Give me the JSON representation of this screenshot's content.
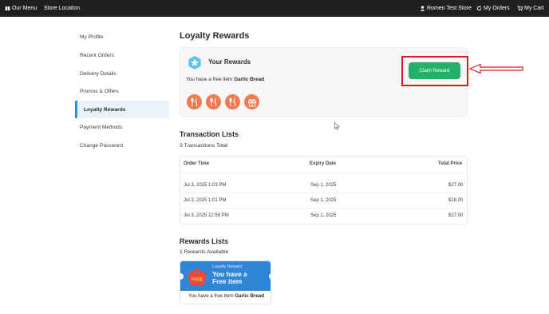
{
  "topbar": {
    "our_menu": "Our Menu",
    "store_location": "Store Location",
    "user_name": "Romeo Test Store",
    "my_orders": "My Orders",
    "my_cart": "My Cart"
  },
  "sidebar": {
    "items": [
      {
        "label": "My Profile"
      },
      {
        "label": "Recent Orders"
      },
      {
        "label": "Delivery Details"
      },
      {
        "label": "Promos & Offers"
      },
      {
        "label": "Loyalty Rewards"
      },
      {
        "label": "Payment Methods"
      },
      {
        "label": "Change Password"
      }
    ],
    "active_index": 4
  },
  "page": {
    "title": "Loyalty Rewards"
  },
  "rewards_card": {
    "heading": "Your Rewards",
    "free_text_prefix": "You have a free item",
    "free_item_name": "Garlic Bread",
    "claim_button": "Claim Reward",
    "stamps": [
      "fork-knife-icon",
      "fork-knife-icon",
      "fork-knife-icon",
      "gift-icon"
    ]
  },
  "transactions": {
    "title": "Transaction Lists",
    "subtitle": "3 Transactions Total",
    "headers": {
      "order_time": "Order Time",
      "expiry_date": "Expiry Date",
      "total_price": "Total Price"
    },
    "rows": [
      {
        "order_time": "Jul 3, 2025 1:03 PM",
        "expiry_date": "Sep 1, 2025",
        "total_price": "$27.00"
      },
      {
        "order_time": "Jul 3, 2025 1:01 PM",
        "expiry_date": "Sep 1, 2025",
        "total_price": "$18.00"
      },
      {
        "order_time": "Jul 3, 2025 12:59 PM",
        "expiry_date": "Sep 1, 2025",
        "total_price": "$27.00"
      }
    ]
  },
  "rewards_list": {
    "title": "Rewards Lists",
    "subtitle": "1 Rewards Available",
    "coupon": {
      "kicker": "Loyalty Reward",
      "headline": "You have a Free item",
      "tag_text": "FREE",
      "caption_prefix": "You have a free item",
      "caption_item": "Garlic Bread"
    }
  },
  "colors": {
    "topbar": "#1f1f1f",
    "accent_blue": "#2d8fe0",
    "claim_green": "#21b268",
    "stamp_orange": "#f07a52",
    "highlight_red": "#d91c24",
    "coupon_blue": "#2f86d6"
  }
}
